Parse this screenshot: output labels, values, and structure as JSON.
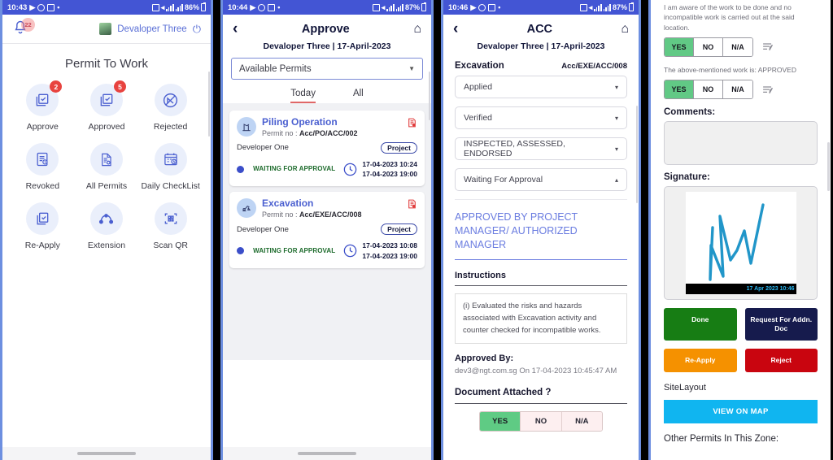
{
  "panel1": {
    "status": {
      "time": "10:43",
      "battery": "86%",
      "icons": [
        "video-icon",
        "circle-k-icon",
        "image-icon",
        "dot-icon",
        "alarm-icon",
        "wifi-icon",
        "sim1-signal-icon",
        "sim2-signal-icon"
      ]
    },
    "bell_badge": "22",
    "user": "Devaloper Three",
    "title": "Permit To Work",
    "tiles": [
      {
        "label": "Approve",
        "badge": "2",
        "icon": "approve-stack-check-icon"
      },
      {
        "label": "Approved",
        "badge": "5",
        "icon": "approved-stack-check-icon"
      },
      {
        "label": "Rejected",
        "badge": "",
        "icon": "rejected-slash-circle-icon"
      },
      {
        "label": "Revoked",
        "badge": "",
        "icon": "revoked-list-clock-icon"
      },
      {
        "label": "All Permits",
        "badge": "",
        "icon": "all-permits-document-icon"
      },
      {
        "label": "Daily CheckList",
        "badge": "",
        "icon": "calendar-clock-icon"
      },
      {
        "label": "Re-Apply",
        "badge": "",
        "icon": "reapply-copy-check-icon"
      },
      {
        "label": "Extension",
        "badge": "",
        "icon": "extension-arc-nodes-icon"
      },
      {
        "label": "Scan QR",
        "badge": "",
        "icon": "scan-qr-icon"
      }
    ]
  },
  "panel2": {
    "status": {
      "time": "10:44",
      "battery": "87%"
    },
    "appbar": {
      "back": "‹",
      "title": "Approve",
      "home": "⌂"
    },
    "subtitle": "Devaloper Three | 17-April-2023",
    "select_value": "Available Permits",
    "tabs": [
      {
        "label": "Today",
        "active": true
      },
      {
        "label": "All",
        "active": false
      }
    ],
    "cards": [
      {
        "name": "Piling Operation",
        "permit_label": "Permit no :",
        "permit_no": "Acc/PO/ACC/002",
        "developer": "Developer One",
        "chip": "Project",
        "status": "WAITING FOR APPROVAL",
        "time_start": "17-04-2023 10:24",
        "time_end": "17-04-2023 19:00",
        "avatar_icon": "piling-machine-icon"
      },
      {
        "name": "Excavation",
        "permit_label": "Permit no :",
        "permit_no": "Acc/EXE/ACC/008",
        "developer": "Developer One",
        "chip": "Project",
        "status": "WAITING FOR APPROVAL",
        "time_start": "17-04-2023 10:08",
        "time_end": "17-04-2023 19:00",
        "avatar_icon": "excavator-icon"
      }
    ]
  },
  "panel3": {
    "status": {
      "time": "10:46",
      "battery": "87%"
    },
    "appbar": {
      "back": "‹",
      "title": "ACC",
      "home": "⌂"
    },
    "subtitle": "Devaloper Three | 17-April-2023",
    "permit_type": "Excavation",
    "permit_no": "Acc/EXE/ACC/008",
    "dropdowns": [
      {
        "value": "Applied",
        "caret": "▾"
      },
      {
        "value": "Verified",
        "caret": "▾"
      },
      {
        "value": "INSPECTED, ASSESSED, ENDORSED",
        "caret": "▾"
      },
      {
        "value": "Waiting For Approval",
        "caret": "▴"
      }
    ],
    "approved_by_heading": "APPROVED BY PROJECT MANAGER/ AUTHORIZED MANAGER",
    "instructions_heading": "Instructions",
    "instructions_text": "(i) Evaluated the risks and hazards associated with Excavation activity and counter checked for incompatible works.",
    "approved_by_label": "Approved By:",
    "approved_by_value": "dev3@ngt.com.sg On 17-04-2023 10:45:47 AM",
    "document_attached_label": "Document Attached ?",
    "yna": [
      {
        "label": "YES",
        "on": true
      },
      {
        "label": "NO",
        "on": false
      },
      {
        "label": "N/A",
        "on": false
      }
    ]
  },
  "panel4": {
    "questions": [
      {
        "text": "I am aware of the work to be done and no incompatible work is carried out at the said location.",
        "options": [
          {
            "label": "YES",
            "on": true
          },
          {
            "label": "NO",
            "on": false
          },
          {
            "label": "N/A",
            "on": false
          }
        ],
        "edit_icon": "edit-lines-pencil-icon"
      },
      {
        "text": "The above-mentioned work is: APPROVED",
        "options": [
          {
            "label": "YES",
            "on": true
          },
          {
            "label": "NO",
            "on": false
          },
          {
            "label": "N/A",
            "on": false
          }
        ],
        "edit_icon": "edit-lines-pencil-icon"
      }
    ],
    "comments_label": "Comments:",
    "comments_value": "",
    "signature_label": "Signature:",
    "signature_stamp": "17 Apr 2023 10:46",
    "buttons": [
      {
        "label": "Done",
        "color": "#177d14"
      },
      {
        "label": "Request For Addn. Doc",
        "color": "#161b4d"
      },
      {
        "label": "Re-Apply",
        "color": "#f59100"
      },
      {
        "label": "Reject",
        "color": "#c9050f"
      }
    ],
    "site_layout_label": "SiteLayout",
    "view_on_map_label": "VIEW ON MAP",
    "other_permits_label": "Other Permits In This Zone:"
  }
}
